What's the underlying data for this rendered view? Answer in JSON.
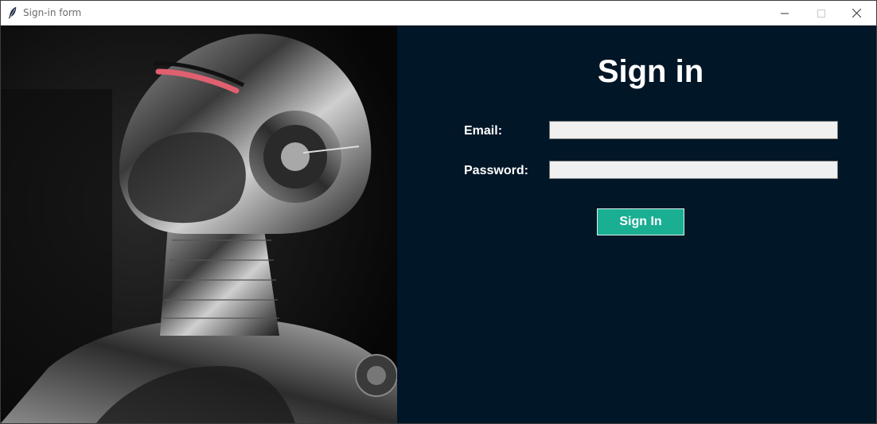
{
  "window": {
    "title": "Sign-in form",
    "app_icon": "feather-icon"
  },
  "window_controls": {
    "minimize_icon": "minimize-icon",
    "maximize_icon": "maximize-icon",
    "close_icon": "close-icon"
  },
  "image_panel": {
    "description_icon": "robot-illustration"
  },
  "form": {
    "heading": "Sign in",
    "email_label": "Email:",
    "email_value": "",
    "password_label": "Password:",
    "password_value": "",
    "submit_label": "Sign In"
  },
  "colors": {
    "form_background": "#011627",
    "button_accent": "#1aae92",
    "field_background": "#f0f0f0"
  }
}
